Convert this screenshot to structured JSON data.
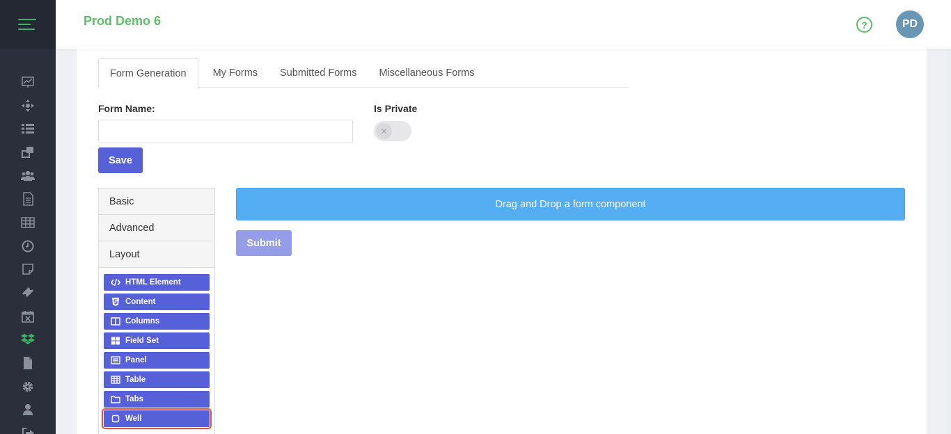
{
  "header": {
    "brand": "Prod Demo 6",
    "help_glyph": "?",
    "avatar_initials": "PD"
  },
  "sidebar": {
    "icons": [
      "chart-line-icon",
      "arrows-move-icon",
      "list-icon",
      "windows-icon",
      "users-icon",
      "document-icon",
      "table-grid-icon",
      "clock-icon",
      "sticky-note-icon",
      "ticket-icon",
      "calendar-x-icon",
      "dropbox-icon",
      "file-icon",
      "gear-icon",
      "user-icon",
      "sign-out-icon"
    ],
    "active_color": "#3fb36a",
    "icon_color": "#8a8f9c"
  },
  "tabs": [
    {
      "label": "Form Generation",
      "active": true
    },
    {
      "label": "My Forms",
      "active": false
    },
    {
      "label": "Submitted Forms",
      "active": false
    },
    {
      "label": "Miscellaneous Forms",
      "active": false
    }
  ],
  "form": {
    "name_label": "Form Name:",
    "name_value": "",
    "private_label": "Is Private",
    "private_on": false,
    "save_label": "Save"
  },
  "builder": {
    "groups": [
      "Basic",
      "Advanced",
      "Layout"
    ],
    "components": [
      {
        "label": "HTML Element",
        "icon": "code-icon"
      },
      {
        "label": "Content",
        "icon": "html5-icon"
      },
      {
        "label": "Columns",
        "icon": "columns-icon"
      },
      {
        "label": "Field Set",
        "icon": "th-large-icon"
      },
      {
        "label": "Panel",
        "icon": "list-alt-icon"
      },
      {
        "label": "Table",
        "icon": "table-icon"
      },
      {
        "label": "Tabs",
        "icon": "folder-icon"
      },
      {
        "label": "Well",
        "icon": "square-icon"
      }
    ],
    "dropzone_text": "Drag and Drop a form component",
    "submit_label": "Submit"
  },
  "colors": {
    "brand": "#5cbf6c",
    "primary": "#5661d9",
    "dropzone": "#56aef2",
    "sidebar": "#2b2f3b"
  }
}
